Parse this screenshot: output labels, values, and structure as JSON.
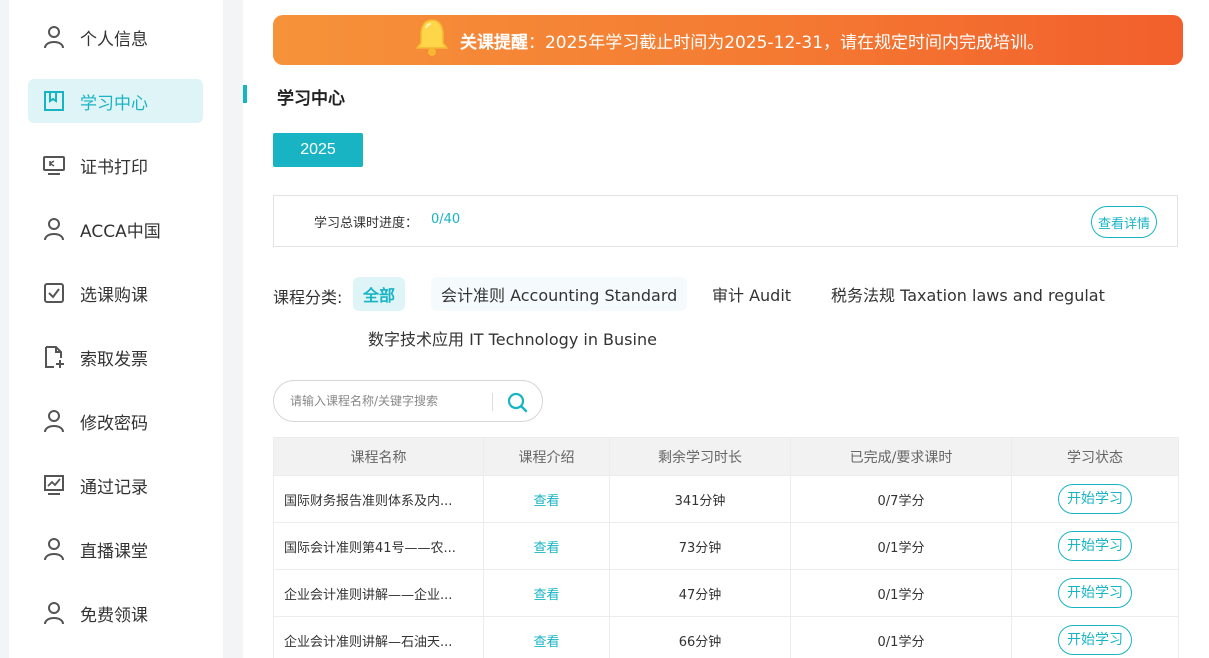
{
  "sidebar": {
    "items": [
      {
        "label": "个人信息",
        "icon": "user-icon"
      },
      {
        "label": "学习中心",
        "icon": "bookmark-icon",
        "active": true
      },
      {
        "label": "证书打印",
        "icon": "monitor-icon"
      },
      {
        "label": "ACCA中国",
        "icon": "user-icon"
      },
      {
        "label": "选课购课",
        "icon": "checkbox-icon"
      },
      {
        "label": "索取发票",
        "icon": "file-plus-icon"
      },
      {
        "label": "修改密码",
        "icon": "user-icon"
      },
      {
        "label": "通过记录",
        "icon": "chart-icon"
      },
      {
        "label": "直播课堂",
        "icon": "user-icon"
      },
      {
        "label": "免费领课",
        "icon": "user-icon"
      }
    ]
  },
  "notice": {
    "title": "关课提醒",
    "text": "：2025年学习截止时间为2025-12-31，请在规定时间内完成培训。"
  },
  "section_title": "学习中心",
  "year_button": "2025",
  "progress": {
    "label": "学习总课时进度：",
    "value": "0/40",
    "detail_button": "查看详情"
  },
  "categories": {
    "label": "课程分类:",
    "items": [
      "全部",
      "会计准则 Accounting Standard",
      "审计 Audit",
      "税务法规 Taxation laws and regulat",
      "数字技术应用 IT Technology in Busine"
    ]
  },
  "search": {
    "placeholder": "请输入课程名称/关键字搜索"
  },
  "table": {
    "headers": [
      "课程名称",
      "课程介绍",
      "剩余学习时长",
      "已完成/要求课时",
      "学习状态"
    ],
    "rows": [
      {
        "name": "国际财务报告准则体系及内...",
        "intro": "查看",
        "remaining": "341分钟",
        "credits": "0/7学分",
        "status": "开始学习"
      },
      {
        "name": "国际会计准则第41号——农...",
        "intro": "查看",
        "remaining": "73分钟",
        "credits": "0/1学分",
        "status": "开始学习"
      },
      {
        "name": "企业会计准则讲解——企业...",
        "intro": "查看",
        "remaining": "47分钟",
        "credits": "0/1学分",
        "status": "开始学习"
      },
      {
        "name": "企业会计准则讲解—石油天...",
        "intro": "查看",
        "remaining": "66分钟",
        "credits": "0/1学分",
        "status": "开始学习"
      }
    ]
  },
  "colors": {
    "accent": "#19b4c4",
    "notice_start": "#f6923a",
    "notice_end": "#f25f2c"
  }
}
